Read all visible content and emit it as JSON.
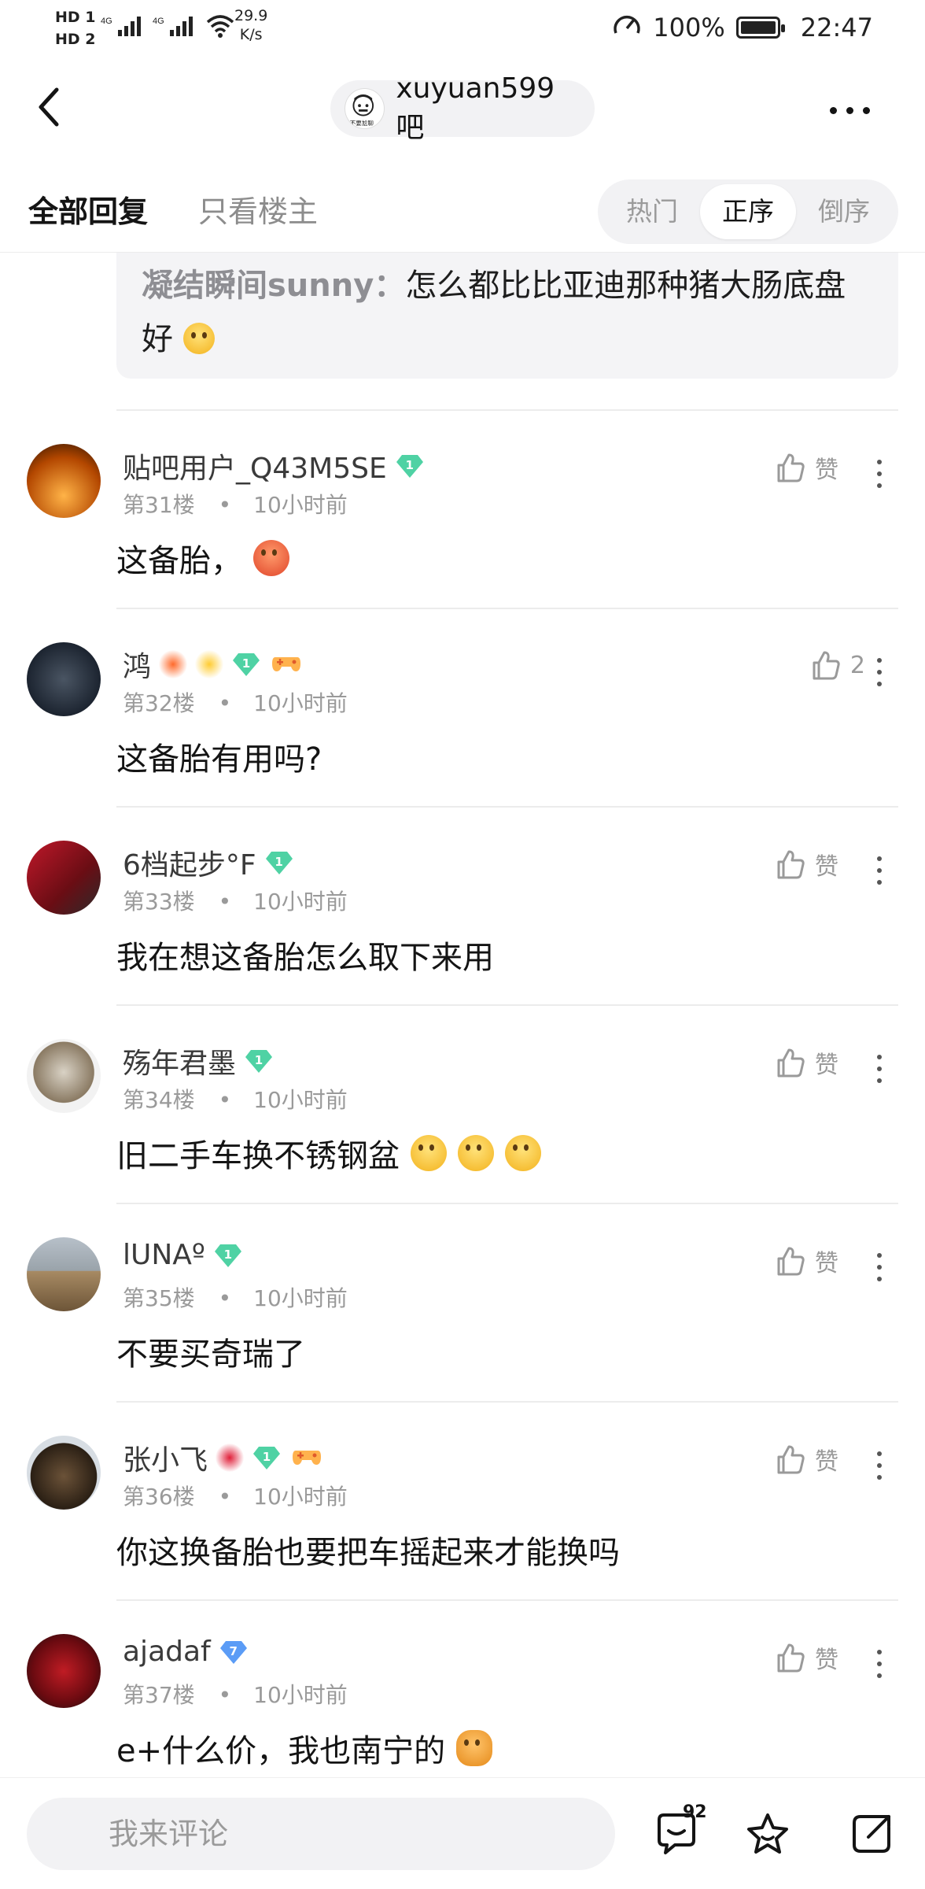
{
  "status_bar": {
    "sim1": "HD 1",
    "sim2": "HD 2",
    "net1": "4G",
    "net2": "4G",
    "speed_value": "29.9",
    "speed_unit": "K/s",
    "battery": "100%",
    "time": "22:47"
  },
  "header": {
    "forum_name": "xuyuan599吧",
    "forum_avatar_text": "不要尬聊"
  },
  "tabs": {
    "all": "全部回复",
    "host_only": "只看楼主",
    "sort": [
      "热门",
      "正序",
      "倒序"
    ],
    "sort_active": "正序"
  },
  "quote": {
    "name": "凝结瞬间sunny：",
    "text": "怎么都比比亚迪那种猪大肠底盘好"
  },
  "posts": [
    {
      "username": "贴吧用户_Q43M5SE",
      "level": "1",
      "floor": "第31楼",
      "time": "10小时前",
      "content": "这备胎，",
      "likes": "赞"
    },
    {
      "username": "鸿",
      "level": "1",
      "floor": "第32楼",
      "time": "10小时前",
      "content": "这备胎有用吗?",
      "likes": "2"
    },
    {
      "username": "6档起步°F",
      "level": "1",
      "floor": "第33楼",
      "time": "10小时前",
      "content": "我在想这备胎怎么取下来用",
      "likes": "赞"
    },
    {
      "username": "殇年君墨",
      "level": "1",
      "floor": "第34楼",
      "time": "10小时前",
      "content": "旧二手车换不锈钢盆",
      "likes": "赞"
    },
    {
      "username": "lUNAº",
      "level": "1",
      "floor": "第35楼",
      "time": "10小时前",
      "content": "不要买奇瑞了",
      "likes": "赞"
    },
    {
      "username": "张小飞",
      "level": "1",
      "floor": "第36楼",
      "time": "10小时前",
      "content": "你这换备胎也要把车摇起来才能换吗",
      "likes": "赞"
    },
    {
      "username": "ajadaf",
      "level": "7",
      "floor": "第37楼",
      "time": "10小时前",
      "content": "e+什么价，我也南宁的",
      "likes": "赞"
    }
  ],
  "bottom_bar": {
    "placeholder": "我来评论",
    "comment_count": "92"
  },
  "colors": {
    "badge_green": "#4fd2a4",
    "badge_blue": "#5b9cf6",
    "muted": "#9a9a9a"
  }
}
